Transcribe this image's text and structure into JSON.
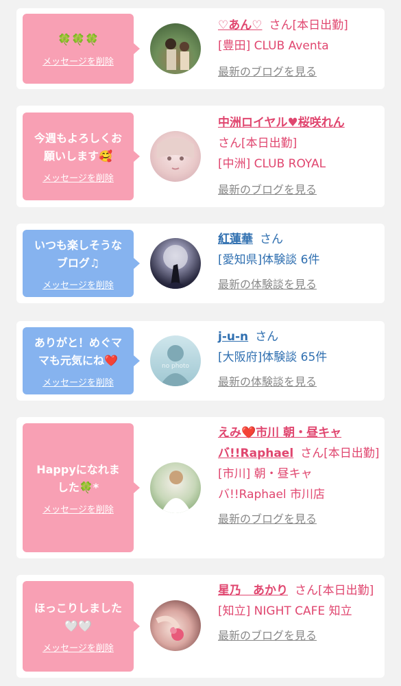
{
  "colors": {
    "pink_bubble": "#f8a0b4",
    "blue_bubble": "#86b3ef",
    "pink_text": "#e0466f",
    "blue_text": "#2f6fb0",
    "link": "#888888"
  },
  "delete_label": "メッセージを削除",
  "cards": [
    {
      "message": "🍀🍀🍀",
      "name": "♡あん♡",
      "suffix": "さん[本日出勤]",
      "sub": "[豊田] CLUB Aventa",
      "link": "最新のブログを見る",
      "avatar_icon": "woman-kimono-photo"
    },
    {
      "message": "今週もよろしくお\n願いします🥰",
      "name": "中洲ロイヤル♥桜咲れん",
      "suffix": "さん[本日出勤]",
      "sub": "[中洲] CLUB ROYAL",
      "link": "最新のブログを見る",
      "avatar_icon": "girl-portrait-photo"
    },
    {
      "message": "いつも楽しそうな\nブログ♫",
      "name": "紅蓮華",
      "suffix": "さん",
      "sub": "[愛知県]体験談 6件",
      "link": "最新の体験談を見る",
      "avatar_icon": "moon-silhouette-photo"
    },
    {
      "message": "ありがと！めぐマ\nマも元気にね❤️",
      "name": "j-u-n",
      "suffix": "さん",
      "sub": "[大阪府]体験談 65件",
      "link": "最新の体験談を見る",
      "avatar_icon": "no-photo-placeholder",
      "nophoto": "no photo"
    },
    {
      "message": "Happyになれま\nした🍀*",
      "name": "えみ❤️市川 朝・昼キャバ!!Raphael",
      "suffix": "さん[本日出勤]",
      "sub": "[市川] 朝・昼キャバ!!Raphael 市川店",
      "link": "最新のブログを見る",
      "avatar_icon": "woman-white-top-photo"
    },
    {
      "message": "ほっこりしました\n🤍🤍",
      "name": "星乃　あかり",
      "suffix": "さん[本日出勤]",
      "sub": "[知立] NIGHT CAFE 知立",
      "link": "最新のブログを見る",
      "avatar_icon": "flower-hands-photo"
    }
  ]
}
